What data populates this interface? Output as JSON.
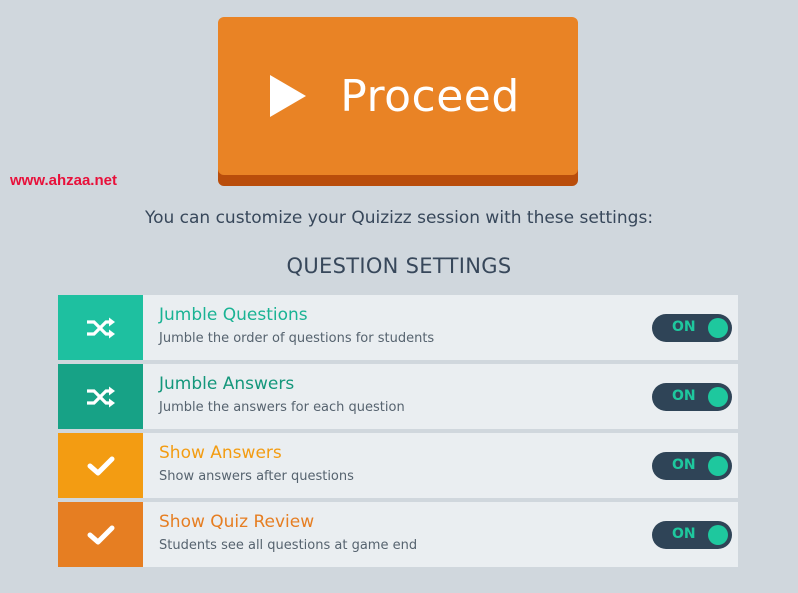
{
  "watermark": "www.ahzaa.net",
  "proceed": {
    "label": "Proceed"
  },
  "subtitle": "You can customize your Quizizz session with these settings:",
  "section_title": "QUESTION SETTINGS",
  "settings": [
    {
      "title": "Jumble Questions",
      "description": "Jumble the order of questions for students",
      "toggle": "ON",
      "icon": "shuffle-icon",
      "icon_bg": "#1ec0a0",
      "title_color": "#1ab394"
    },
    {
      "title": "Jumble Answers",
      "description": "Jumble the answers for each question",
      "toggle": "ON",
      "icon": "shuffle-icon",
      "icon_bg": "#17a286",
      "title_color": "#14977b"
    },
    {
      "title": "Show Answers",
      "description": "Show answers after questions",
      "toggle": "ON",
      "icon": "check-icon",
      "icon_bg": "#f39c12",
      "title_color": "#f39c12"
    },
    {
      "title": "Show Quiz Review",
      "description": "Students see all questions at game end",
      "toggle": "ON",
      "icon": "check-icon",
      "icon_bg": "#e67e22",
      "title_color": "#e67e22"
    }
  ],
  "colors": {
    "background": "#d0d7dd",
    "proceed_button": "#e98325",
    "toggle_track": "#2f4457",
    "toggle_on": "#1ec89e"
  }
}
